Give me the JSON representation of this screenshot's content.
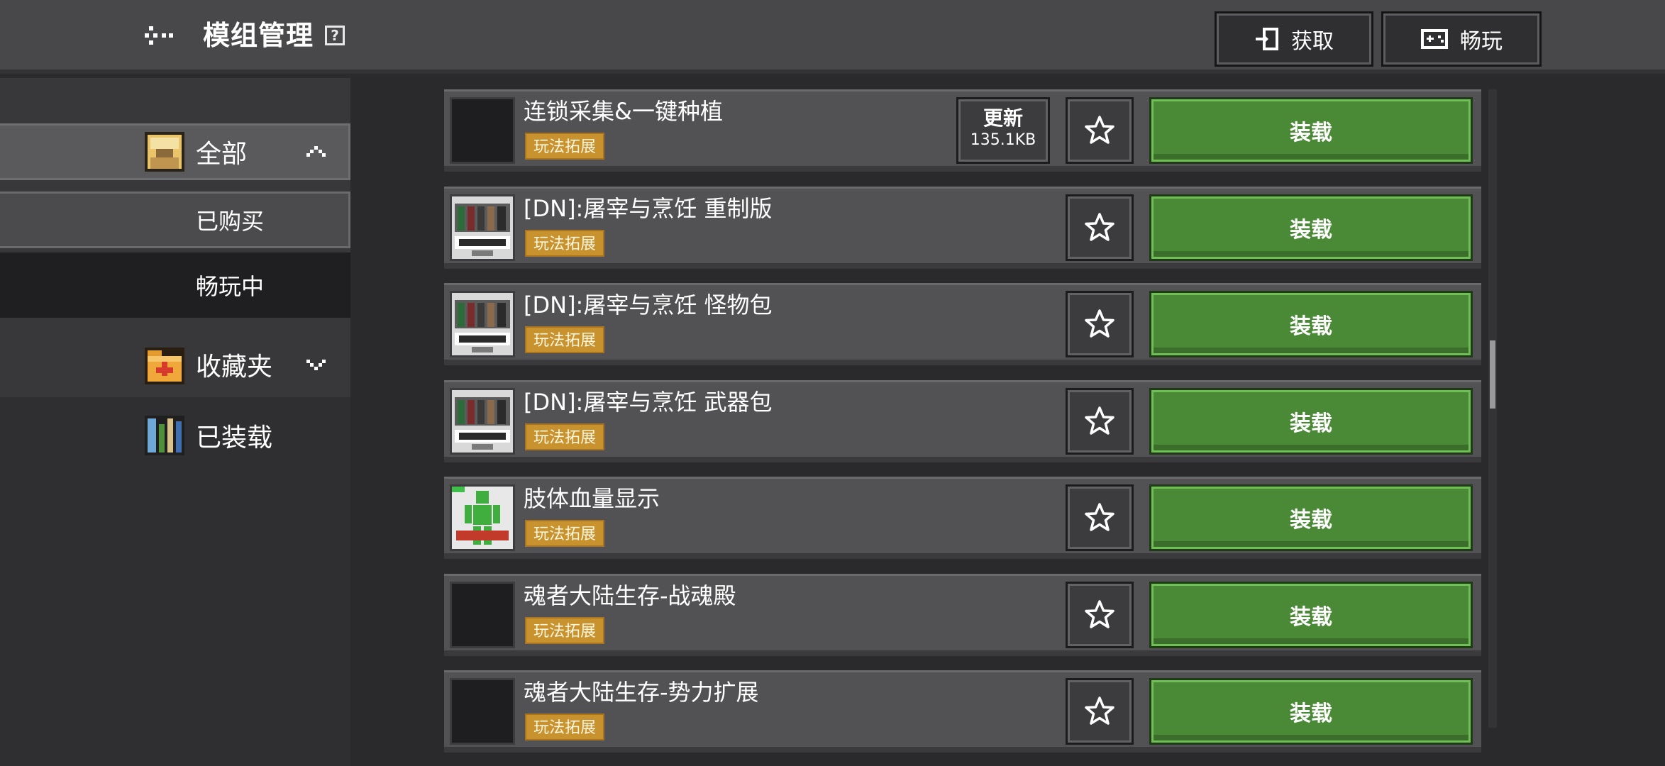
{
  "header": {
    "title": "模组管理",
    "help_symbol": "?",
    "get_button": "获取",
    "play_button": "畅玩"
  },
  "sidebar": {
    "all": "全部",
    "bought": "已购买",
    "playing": "畅玩中",
    "favorites": "收藏夹",
    "loaded": "已装载"
  },
  "mods": [
    {
      "name": "连锁采集&一键种植",
      "tag": "玩法拓展",
      "thumb": "blank",
      "update": {
        "title": "更新",
        "size": "135.1KB"
      },
      "load_label": "装载"
    },
    {
      "name": "[DN]:屠宰与烹饪 重制版",
      "tag": "玩法拓展",
      "thumb": "butcher",
      "load_label": "装载"
    },
    {
      "name": "[DN]:屠宰与烹饪 怪物包",
      "tag": "玩法拓展",
      "thumb": "butcher",
      "load_label": "装载"
    },
    {
      "name": "[DN]:屠宰与烹饪 武器包",
      "tag": "玩法拓展",
      "thumb": "butcher",
      "load_label": "装载"
    },
    {
      "name": "肢体血量显示",
      "tag": "玩法拓展",
      "thumb": "limb",
      "load_label": "装载"
    },
    {
      "name": "魂者大陆生存-战魂殿",
      "tag": "玩法拓展",
      "thumb": "blank",
      "load_label": "装载"
    },
    {
      "name": "魂者大陆生存-势力扩展",
      "tag": "玩法拓展",
      "thumb": "blank",
      "load_label": "装载"
    }
  ],
  "icons": {
    "back": "back-arrow-icon",
    "get": "import-icon",
    "play": "gamepad-icon",
    "star": "star-outline-icon"
  },
  "colors": {
    "header": "#48484b",
    "load_green": "#4a8a37",
    "tag_gold": "#c8922e"
  }
}
